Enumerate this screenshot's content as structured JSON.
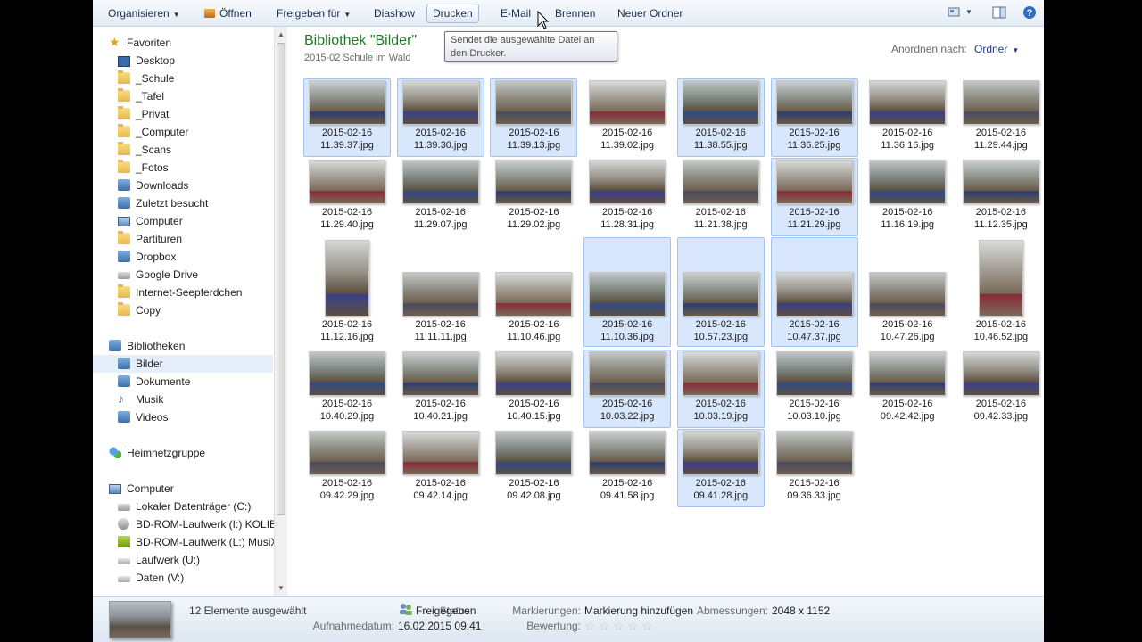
{
  "toolbar": {
    "organize": "Organisieren",
    "open": "Öffnen",
    "share": "Freigeben für",
    "slideshow": "Diashow",
    "print": "Drucken",
    "email": "E-Mail",
    "burn": "Brennen",
    "new_folder": "Neuer Ordner"
  },
  "tooltip": "Sendet die ausgewählte Datei an den Drucker.",
  "nav": {
    "favorites": {
      "header": "Favoriten",
      "items": [
        "Desktop",
        "_Schule",
        "_Tafel",
        "_Privat",
        "_Computer",
        "_Scans",
        "_Fotos",
        "Downloads",
        "Zuletzt besucht",
        "Computer",
        "Partituren",
        "Dropbox",
        "Google Drive",
        "Internet-Seepferdchen",
        "Copy"
      ]
    },
    "libraries": {
      "header": "Bibliotheken",
      "items": [
        "Bilder",
        "Dokumente",
        "Musik",
        "Videos"
      ]
    },
    "homegroup": "Heimnetzgruppe",
    "computer": {
      "header": "Computer",
      "items": [
        "Lokaler Datenträger (C:)",
        "BD-ROM-Laufwerk (I:) KOLIBRI",
        "BD-ROM-Laufwerk (L:) MusiX 1",
        "Laufwerk (U:)",
        "Daten (V:)"
      ]
    }
  },
  "library": {
    "title": "Bibliothek \"Bilder\"",
    "subtitle": "2015-02 Schule im Wald",
    "sort_label": "Anordnen nach:",
    "sort_value": "Ordner"
  },
  "files": [
    {
      "date": "2015-02-16",
      "time": "11.39.37.jpg",
      "selected": true
    },
    {
      "date": "2015-02-16",
      "time": "11.39.30.jpg",
      "selected": true
    },
    {
      "date": "2015-02-16",
      "time": "11.39.13.jpg",
      "selected": true
    },
    {
      "date": "2015-02-16",
      "time": "11.39.02.jpg",
      "selected": false
    },
    {
      "date": "2015-02-16",
      "time": "11.38.55.jpg",
      "selected": true
    },
    {
      "date": "2015-02-16",
      "time": "11.36.25.jpg",
      "selected": true
    },
    {
      "date": "2015-02-16",
      "time": "11.36.16.jpg",
      "selected": false
    },
    {
      "date": "2015-02-16",
      "time": "11.29.44.jpg",
      "selected": false
    },
    {
      "date": "2015-02-16",
      "time": "11.29.40.jpg",
      "selected": false
    },
    {
      "date": "2015-02-16",
      "time": "11.29.07.jpg",
      "selected": false
    },
    {
      "date": "2015-02-16",
      "time": "11.29.02.jpg",
      "selected": false
    },
    {
      "date": "2015-02-16",
      "time": "11.28.31.jpg",
      "selected": false
    },
    {
      "date": "2015-02-16",
      "time": "11.21.38.jpg",
      "selected": false
    },
    {
      "date": "2015-02-16",
      "time": "11.21.29.jpg",
      "selected": true
    },
    {
      "date": "2015-02-16",
      "time": "11.16.19.jpg",
      "selected": false
    },
    {
      "date": "2015-02-16",
      "time": "11.12.35.jpg",
      "selected": false
    },
    {
      "date": "2015-02-16",
      "time": "11.12.16.jpg",
      "selected": false,
      "portrait": true
    },
    {
      "date": "2015-02-16",
      "time": "11.11.11.jpg",
      "selected": false
    },
    {
      "date": "2015-02-16",
      "time": "11.10.46.jpg",
      "selected": false
    },
    {
      "date": "2015-02-16",
      "time": "11.10.36.jpg",
      "selected": true
    },
    {
      "date": "2015-02-16",
      "time": "10.57.23.jpg",
      "selected": true
    },
    {
      "date": "2015-02-16",
      "time": "10.47.37.jpg",
      "selected": true
    },
    {
      "date": "2015-02-16",
      "time": "10.47.26.jpg",
      "selected": false
    },
    {
      "date": "2015-02-16",
      "time": "10.46.52.jpg",
      "selected": false,
      "portrait": true
    },
    {
      "date": "2015-02-16",
      "time": "10.40.29.jpg",
      "selected": false
    },
    {
      "date": "2015-02-16",
      "time": "10.40.21.jpg",
      "selected": false
    },
    {
      "date": "2015-02-16",
      "time": "10.40.15.jpg",
      "selected": false
    },
    {
      "date": "2015-02-16",
      "time": "10.03.22.jpg",
      "selected": true
    },
    {
      "date": "2015-02-16",
      "time": "10.03.19.jpg",
      "selected": true
    },
    {
      "date": "2015-02-16",
      "time": "10.03.10.jpg",
      "selected": false
    },
    {
      "date": "2015-02-16",
      "time": "09.42.42.jpg",
      "selected": false
    },
    {
      "date": "2015-02-16",
      "time": "09.42.33.jpg",
      "selected": false
    },
    {
      "date": "2015-02-16",
      "time": "09.42.29.jpg",
      "selected": false
    },
    {
      "date": "2015-02-16",
      "time": "09.42.14.jpg",
      "selected": false
    },
    {
      "date": "2015-02-16",
      "time": "09.42.08.jpg",
      "selected": false
    },
    {
      "date": "2015-02-16",
      "time": "09.41.58.jpg",
      "selected": false
    },
    {
      "date": "2015-02-16",
      "time": "09.41.28.jpg",
      "selected": true
    },
    {
      "date": "2015-02-16",
      "time": "09.36.33.jpg",
      "selected": false
    }
  ],
  "status": {
    "count": "12 Elemente ausgewählt",
    "status_label": "Status:",
    "status_value": "Freigegeben",
    "date_label": "Aufnahmedatum:",
    "date_value": "16.02.2015 09:41",
    "tags_label": "Markierungen:",
    "tags_value": "Markierung hinzufügen",
    "rating_label": "Bewertung:",
    "rating_stars": 0,
    "dims_label": "Abmessungen:",
    "dims_value": "2048 x 1152"
  },
  "colors": {
    "title_green": "#1e7a24",
    "selection_fill": "#d8e7fb",
    "selection_border": "#a2c4ee"
  }
}
